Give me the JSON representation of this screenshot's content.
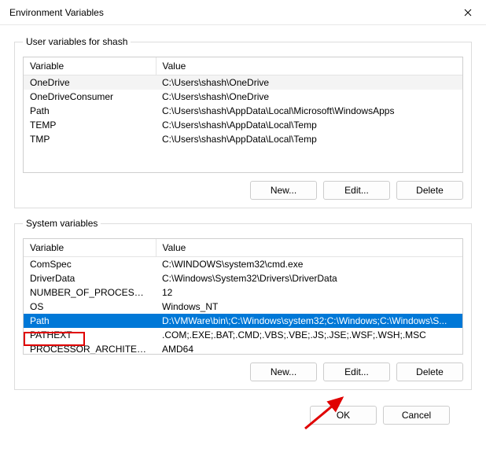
{
  "window": {
    "title": "Environment Variables"
  },
  "user_group": {
    "legend": "User variables for shash",
    "col_var": "Variable",
    "col_val": "Value",
    "rows": [
      {
        "var": "OneDrive",
        "val": "C:\\Users\\shash\\OneDrive"
      },
      {
        "var": "OneDriveConsumer",
        "val": "C:\\Users\\shash\\OneDrive"
      },
      {
        "var": "Path",
        "val": "C:\\Users\\shash\\AppData\\Local\\Microsoft\\WindowsApps"
      },
      {
        "var": "TEMP",
        "val": "C:\\Users\\shash\\AppData\\Local\\Temp"
      },
      {
        "var": "TMP",
        "val": "C:\\Users\\shash\\AppData\\Local\\Temp"
      }
    ],
    "btn_new": "New...",
    "btn_edit": "Edit...",
    "btn_delete": "Delete"
  },
  "sys_group": {
    "legend": "System variables",
    "col_var": "Variable",
    "col_val": "Value",
    "rows": [
      {
        "var": "ComSpec",
        "val": "C:\\WINDOWS\\system32\\cmd.exe"
      },
      {
        "var": "DriverData",
        "val": "C:\\Windows\\System32\\Drivers\\DriverData"
      },
      {
        "var": "NUMBER_OF_PROCESSORS",
        "val": "12"
      },
      {
        "var": "OS",
        "val": "Windows_NT"
      },
      {
        "var": "Path",
        "val": "D:\\VMWare\\bin\\;C:\\Windows\\system32;C:\\Windows;C:\\Windows\\S..."
      },
      {
        "var": "PATHEXT",
        "val": ".COM;.EXE;.BAT;.CMD;.VBS;.VBE;.JS;.JSE;.WSF;.WSH;.MSC"
      },
      {
        "var": "PROCESSOR_ARCHITECTURE",
        "val": "AMD64"
      }
    ],
    "selected_index": 4,
    "btn_new": "New...",
    "btn_edit": "Edit...",
    "btn_delete": "Delete"
  },
  "dialog": {
    "ok": "OK",
    "cancel": "Cancel"
  },
  "annotation": {
    "highlight_row_label": "Path"
  }
}
